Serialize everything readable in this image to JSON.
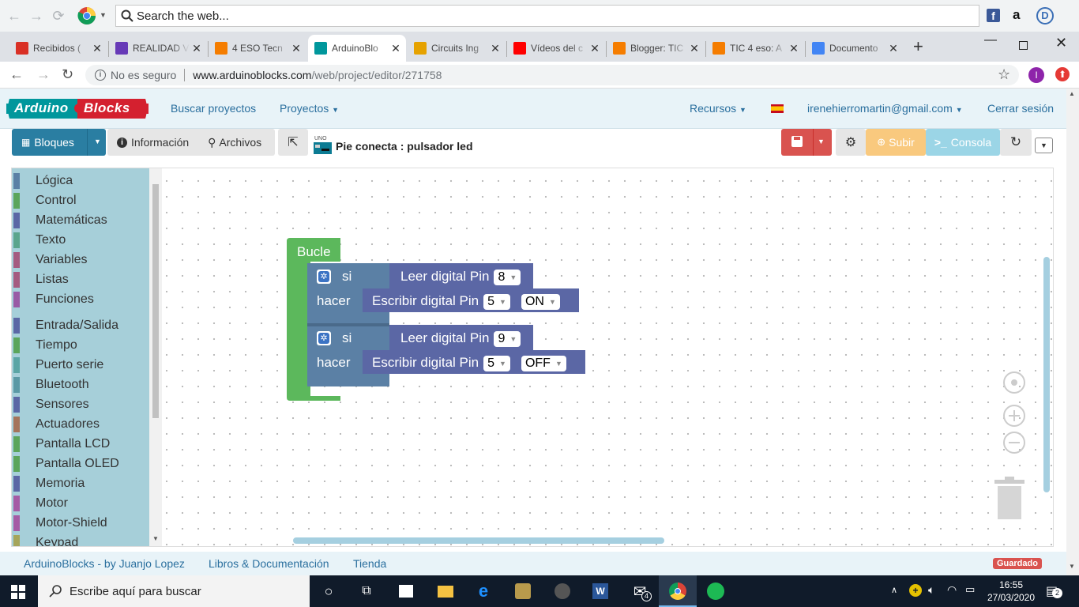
{
  "browser": {
    "search_placeholder": "Search the web...",
    "tabs": [
      {
        "label": "Recibidos (",
        "icon": "gmail-icon",
        "color": "#d93025"
      },
      {
        "label": "REALIDAD V",
        "icon": "form-icon",
        "color": "#673ab7"
      },
      {
        "label": "4 ESO Tecn",
        "icon": "blogger-icon",
        "color": "#f57d00"
      },
      {
        "label": "ArduinoBlo",
        "icon": "arduino-icon",
        "color": "#00979c"
      },
      {
        "label": "Circuits Ing",
        "icon": "grid-icon",
        "color": "#e6a200"
      },
      {
        "label": "Vídeos del c",
        "icon": "youtube-icon",
        "color": "#ff0000"
      },
      {
        "label": "Blogger: TIC",
        "icon": "blogger-icon",
        "color": "#f57d00"
      },
      {
        "label": "TIC 4 eso: A",
        "icon": "blogger-icon",
        "color": "#f57d00"
      },
      {
        "label": "Documento",
        "icon": "docs-icon",
        "color": "#4285f4"
      }
    ],
    "not_secure": "No es seguro",
    "url_domain": "www.arduinoblocks.com",
    "url_path": "/web/project/editor/271758",
    "profile_initial": "I"
  },
  "app": {
    "logo_left": "Arduino",
    "logo_right": "Blocks",
    "nav": {
      "search_projects": "Buscar proyectos",
      "projects": "Proyectos",
      "resources": "Recursos",
      "user_email": "irenehierromartin@gmail.com",
      "logout": "Cerrar sesión"
    },
    "toolbar": {
      "blocks": "Bloques",
      "info": "Información",
      "files": "Archivos",
      "board_label": "UNO",
      "project_title": "Pie conecta : pulsador led",
      "upload": "Subir",
      "console": "Consola"
    },
    "categories": [
      {
        "label": "Lógica",
        "color": "#5b80a5"
      },
      {
        "label": "Control",
        "color": "#5ba55b"
      },
      {
        "label": "Matemáticas",
        "color": "#5b67a5"
      },
      {
        "label": "Texto",
        "color": "#5ba58c"
      },
      {
        "label": "Variables",
        "color": "#a55b80"
      },
      {
        "label": "Listas",
        "color": "#a55b80"
      },
      {
        "label": "Funciones",
        "color": "#995ba5"
      },
      {
        "label": "Entrada/Salida",
        "color": "#5b67a5"
      },
      {
        "label": "Tiempo",
        "color": "#5ba55b"
      },
      {
        "label": "Puerto serie",
        "color": "#5ba5a5"
      },
      {
        "label": "Bluetooth",
        "color": "#5b99a5"
      },
      {
        "label": "Sensores",
        "color": "#5b67a5"
      },
      {
        "label": "Actuadores",
        "color": "#a5745b"
      },
      {
        "label": "Pantalla LCD",
        "color": "#5ba55b"
      },
      {
        "label": "Pantalla OLED",
        "color": "#5ba55b"
      },
      {
        "label": "Memoria",
        "color": "#5b67a5"
      },
      {
        "label": "Motor",
        "color": "#a55ba5"
      },
      {
        "label": "Motor-Shield",
        "color": "#a55ba5"
      },
      {
        "label": "Keypad",
        "color": "#a5a55b"
      }
    ],
    "blocks": {
      "loop": "Bucle",
      "if1": {
        "si": "si",
        "hacer": "hacer",
        "read": "Leer digital Pin",
        "read_pin": "8",
        "write": "Escribir digital Pin",
        "write_pin": "5",
        "state": "ON"
      },
      "if2": {
        "si": "si",
        "hacer": "hacer",
        "read": "Leer digital Pin",
        "read_pin": "9",
        "write": "Escribir digital Pin",
        "write_pin": "5",
        "state": "OFF"
      }
    },
    "footer": {
      "credit": "ArduinoBlocks - by Juanjo Lopez",
      "books": "Libros & Documentación",
      "store": "Tienda",
      "saved": "Guardado"
    }
  },
  "taskbar": {
    "search_placeholder": "Escribe aquí para buscar",
    "time": "16:55",
    "date": "27/03/2020",
    "mail_badge": "4",
    "notif_badge": "2"
  }
}
